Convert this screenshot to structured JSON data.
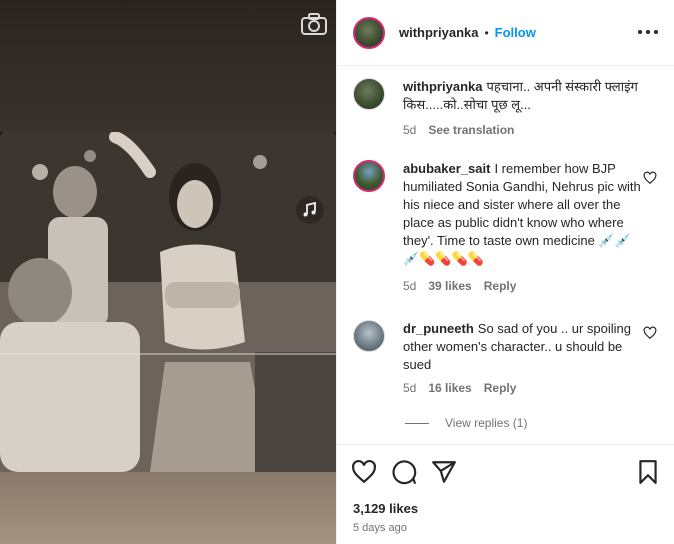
{
  "post": {
    "author": "withpriyanka",
    "follow_label": "Follow",
    "separator": "•",
    "caption_user": "withpriyanka",
    "caption_text": "पहचाना.. अपनी संस्कारी फ्लाइंग किस.....को..सोचा पूछ लू...",
    "caption_age": "5d",
    "see_translation": "See translation"
  },
  "comments": [
    {
      "user": "abubaker_sait",
      "text": "I remember how BJP humiliated Sonia Gandhi, Nehrus pic with his niece and sister where all over the place as public didn't know who where they'. Time to taste own medicine 💉💉💉💊💊💊💊",
      "age": "5d",
      "likes": "39 likes",
      "reply": "Reply"
    },
    {
      "user": "dr_puneeth",
      "text": "So sad of you .. ur spoiling other women's character.. u should be sued",
      "age": "5d",
      "likes": "16 likes",
      "reply": "Reply"
    }
  ],
  "view_replies": "View replies (1)",
  "footer": {
    "likes": "3,129 likes",
    "time_ago": "5 days ago"
  },
  "icons": {
    "camera": "camera-icon",
    "audio": "audio-icon",
    "more": "more-options-icon",
    "like": "heart-icon",
    "comment": "comment-icon",
    "share": "share-icon",
    "save": "bookmark-icon"
  }
}
